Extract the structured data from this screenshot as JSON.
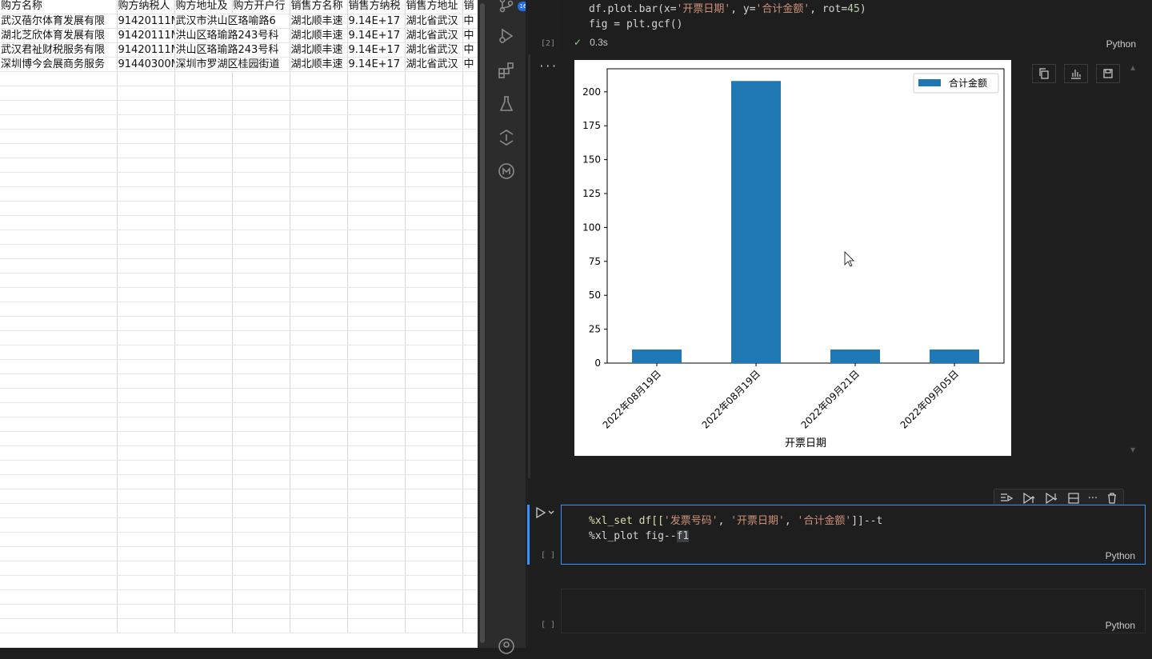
{
  "sheet": {
    "header_row": [
      "购方名称",
      "购方纳税人",
      "购方地址及",
      "购方开户行",
      "销售方名称",
      "销售方纳税",
      "销售方地址",
      "销"
    ],
    "rows": [
      [
        "武汉蓓尔体育发展有限",
        "91420111M",
        "武汉市洪山区珞喻路6",
        "湖北顺丰速",
        "9.14E+17",
        "湖北省武汉",
        "中"
      ],
      [
        "湖北芝欣体育发展有限",
        "91420111M",
        "洪山区珞瑜路243号科",
        "湖北顺丰速",
        "9.14E+17",
        "湖北省武汉",
        "中"
      ],
      [
        "武汉君祉财税服务有限",
        "91420111M",
        "洪山区珞瑜路243号科",
        "湖北顺丰速",
        "9.14E+17",
        "湖北省武汉",
        "中"
      ],
      [
        "深圳博今会展商务服务",
        "91440300M",
        "深圳市罗湖区桂园街道",
        "湖北顺丰速",
        "9.14E+17",
        "湖北省武汉",
        "中"
      ]
    ]
  },
  "activity": {
    "badge": "16",
    "icons": [
      "source-control-icon",
      "run-debug-icon",
      "extensions-icon",
      "testing-icon",
      "jupyter-icon",
      "remote-icon",
      "account-icon"
    ]
  },
  "cell1": {
    "line1_a": "df.plot.bar(x=",
    "line1_s1": "'开票日期'",
    "line1_b": ", y=",
    "line1_s2": "'合计金额'",
    "line1_c": ", rot=",
    "line1_n": "45",
    "line1_d": ")",
    "line2_a": "fig = plt.gcf()",
    "exec_count": "[2]",
    "status_time": "0.3s",
    "language": "Python",
    "output_menu": "···"
  },
  "cell2": {
    "line1_a": "%xl_set df[[",
    "line1_s1": "'发票号码'",
    "line1_s2": "'开票日期'",
    "line1_s3": "'合计金额'",
    "line1_b": "]]--t",
    "line2_a": "%xl_plot fig--",
    "line2_b": "f1",
    "exec_count": "[ ]",
    "language": "Python"
  },
  "cell3": {
    "exec_count": "[ ]",
    "language": "Python"
  },
  "colors": {
    "bar": "#1f77b4",
    "accent": "#3794ff",
    "success": "#89d185"
  },
  "chart_data": {
    "type": "bar",
    "categories": [
      "2022年08月19日",
      "2022年08月19日",
      "2022年09月21日",
      "2022年09月05日"
    ],
    "series": [
      {
        "name": "合计金额",
        "values": [
          10,
          208,
          10,
          10
        ]
      }
    ],
    "xlabel": "开票日期",
    "ylabel": "",
    "ylim": [
      0,
      217
    ],
    "yticks": [
      "0",
      "25",
      "50",
      "75",
      "100",
      "125",
      "150",
      "175",
      "200"
    ],
    "legend": "top-right",
    "grid": false
  }
}
